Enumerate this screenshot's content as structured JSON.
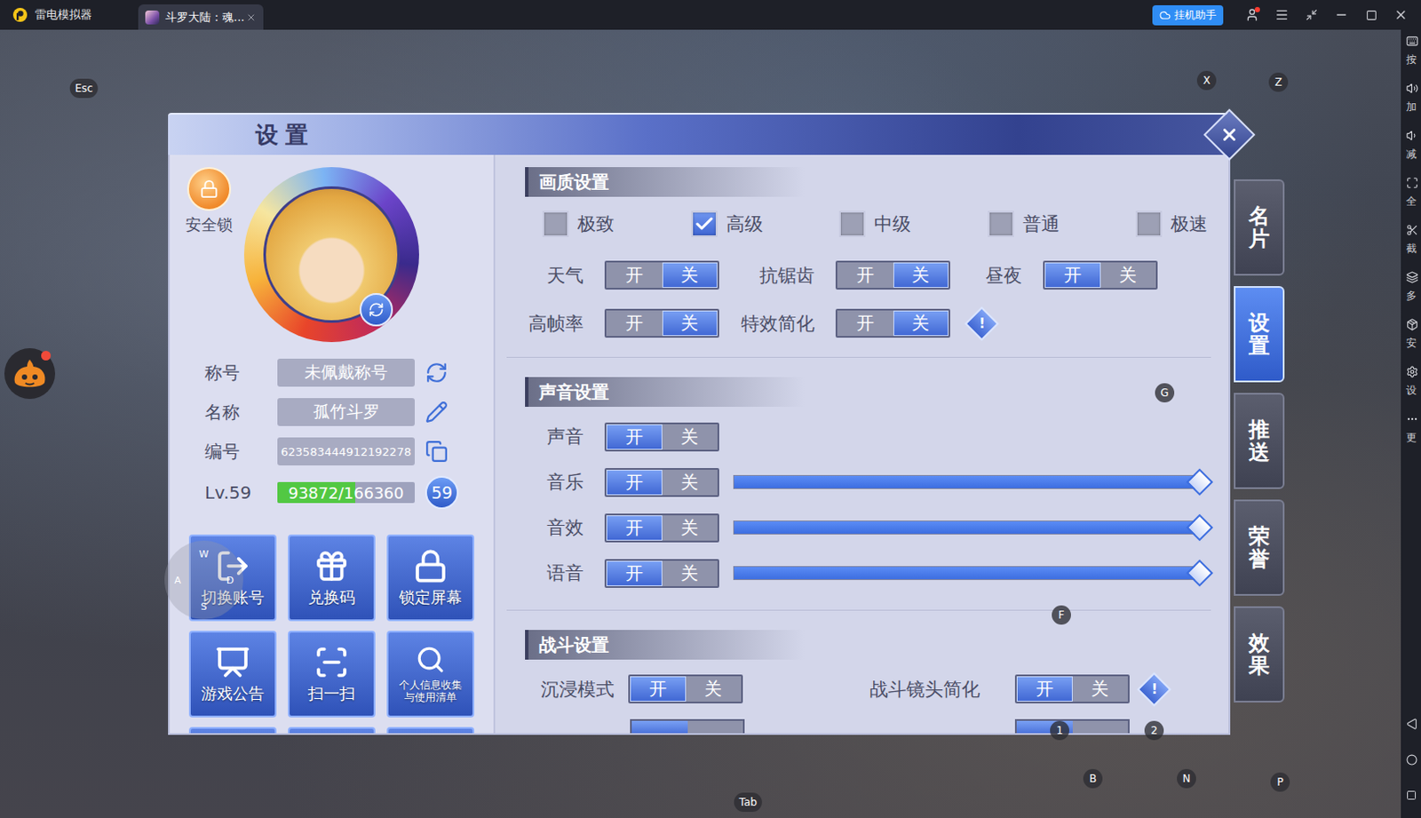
{
  "window": {
    "title": "雷电模拟器",
    "tabs": [
      {
        "label": "斗罗大陆：魂...",
        "selected": true
      }
    ],
    "assistant_button": "挂机助手",
    "account_notice": true
  },
  "sidebar": {
    "items": [
      {
        "label": "按"
      },
      {
        "label": "加"
      },
      {
        "label": "减"
      },
      {
        "label": "全"
      },
      {
        "label": "截"
      },
      {
        "label": "多"
      },
      {
        "label": "安"
      },
      {
        "label": "设"
      },
      {
        "label": "更"
      }
    ]
  },
  "key_overlays": [
    "Esc",
    "X",
    "Z",
    "G",
    "F",
    "1",
    "2",
    "B",
    "N",
    "P",
    "Tab"
  ],
  "joystick": {
    "keys": [
      "W",
      "A",
      "S",
      "D"
    ]
  },
  "buddy": {
    "notice": true
  },
  "dialog": {
    "title": "设置",
    "switch_labels": [
      "开",
      "关"
    ],
    "side_tabs": [
      {
        "label": "名片",
        "selected": false
      },
      {
        "label": "设置",
        "selected": true
      },
      {
        "label": "推送",
        "selected": false
      },
      {
        "label": "荣誉",
        "selected": false
      },
      {
        "label": "效果",
        "selected": false
      }
    ],
    "profile": {
      "lock_label": "安全锁",
      "fields": [
        {
          "label": "称号",
          "value": "未佩戴称号"
        },
        {
          "label": "名称",
          "value": "孤竹斗罗"
        },
        {
          "label": "编号",
          "value": "623583444912192278"
        }
      ],
      "level": {
        "label": "Lv.59",
        "reading": "93872/166360",
        "level": 0.564,
        "badge": "59"
      },
      "buttons": [
        {
          "label": "切换账号",
          "cut": false
        },
        {
          "label": "兑换码",
          "cut": false
        },
        {
          "label": "锁定屏幕",
          "cut": false
        },
        {
          "label": "游戏公告",
          "cut": false
        },
        {
          "label": "扫一扫",
          "cut": false
        },
        {
          "label": "个人信息收集与使用清单",
          "cut": false
        },
        {
          "label": "",
          "cut": true
        },
        {
          "label": "",
          "cut": true
        },
        {
          "label": "",
          "cut": true
        }
      ]
    },
    "graphics": {
      "title": "画质设置",
      "quality": [
        {
          "label": "极致",
          "checked": false
        },
        {
          "label": "高级",
          "checked": true
        },
        {
          "label": "中级",
          "checked": false
        },
        {
          "label": "普通",
          "checked": false
        },
        {
          "label": "极速",
          "checked": false
        }
      ],
      "toggles": [
        {
          "label": "天气",
          "on": false
        },
        {
          "label": "抗锯齿",
          "on": false
        },
        {
          "label": "昼夜",
          "on": true
        },
        {
          "label": "高帧率",
          "on": false
        },
        {
          "label": "特效简化",
          "on": false,
          "info": "!"
        }
      ]
    },
    "sound": {
      "title": "声音设置",
      "rows": [
        {
          "label": "声音",
          "on": true,
          "kind": "toggle"
        },
        {
          "label": "音乐",
          "on": true,
          "kind": "slider",
          "level": 1.0
        },
        {
          "label": "音效",
          "on": true,
          "kind": "slider",
          "level": 1.0
        },
        {
          "label": "语音",
          "on": true,
          "kind": "slider",
          "level": 1.0
        }
      ]
    },
    "battle": {
      "title": "战斗设置",
      "rows": [
        {
          "label": "沉浸模式",
          "on": true
        },
        {
          "label": "战斗镜头简化",
          "on": true,
          "info": "!"
        }
      ],
      "partial": [
        {
          "on": true
        },
        {
          "on": true
        }
      ]
    }
  }
}
